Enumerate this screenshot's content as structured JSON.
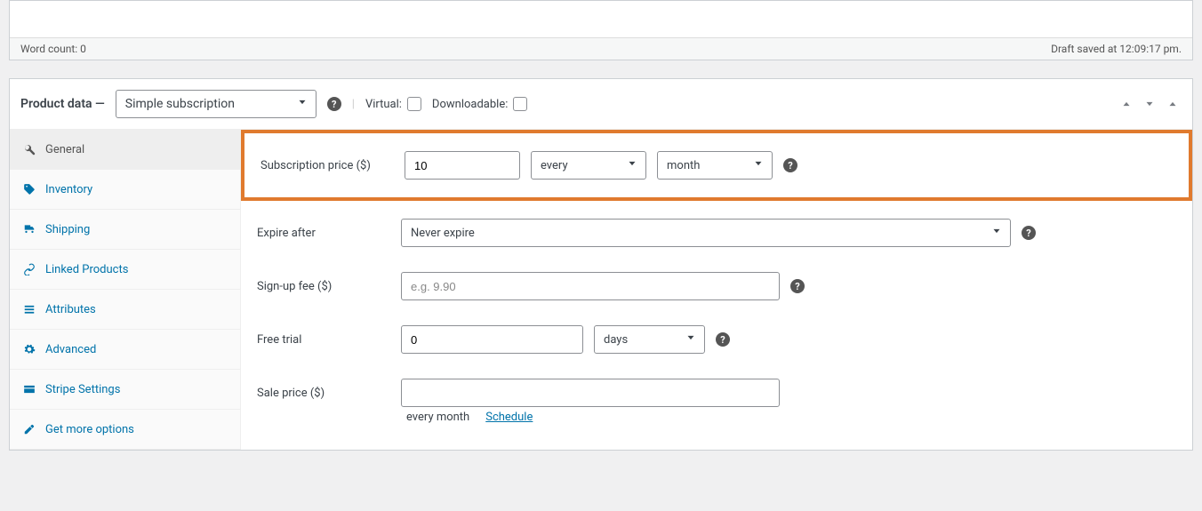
{
  "editor": {
    "word_count_label": "Word count: 0",
    "draft_saved_label": "Draft saved at 12:09:17 pm."
  },
  "panel": {
    "title": "Product data —",
    "type_value": "Simple subscription",
    "virtual_label": "Virtual:",
    "downloadable_label": "Downloadable:"
  },
  "tabs": [
    {
      "label": "General"
    },
    {
      "label": "Inventory"
    },
    {
      "label": "Shipping"
    },
    {
      "label": "Linked Products"
    },
    {
      "label": "Attributes"
    },
    {
      "label": "Advanced"
    },
    {
      "label": "Stripe Settings"
    },
    {
      "label": "Get more options"
    }
  ],
  "fields": {
    "sub_price_label": "Subscription price ($)",
    "sub_price_value": "10",
    "sub_interval_value": "every",
    "sub_period_value": "month",
    "expire_label": "Expire after",
    "expire_value": "Never expire",
    "signup_label": "Sign-up fee ($)",
    "signup_placeholder": "e.g. 9.90",
    "trial_label": "Free trial",
    "trial_value": "0",
    "trial_unit": "days",
    "sale_label": "Sale price ($)",
    "sale_below_text": "every month",
    "sale_schedule": "Schedule"
  }
}
